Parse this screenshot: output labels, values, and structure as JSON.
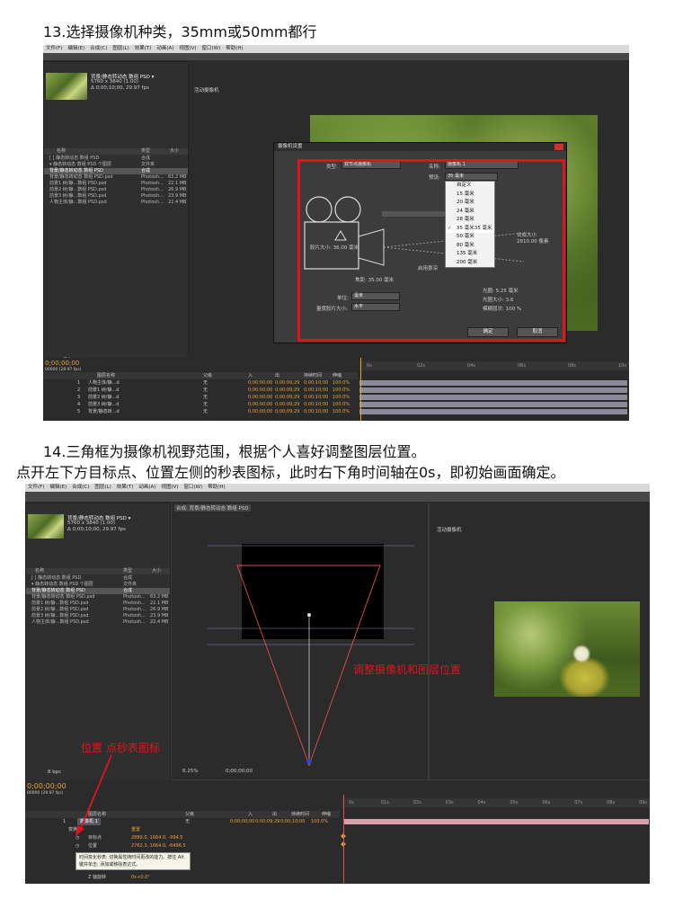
{
  "step13": {
    "heading": "13.选择摄像机种类，35mm或50mm都行"
  },
  "step14": {
    "heading_line1": "14.三角框为摄像机视野范围，根据个人喜好调整图层位置。",
    "heading_line2": "点开左下方目标点、位置左侧的秒表图标，此时右下角时间轴在0s，即初始画面确定。"
  },
  "menu": [
    "文件(F)",
    "编辑(E)",
    "合成(C)",
    "图层(L)",
    "效果(T)",
    "动画(A)",
    "视图(V)",
    "窗口(W)",
    "帮助(H)"
  ],
  "project": {
    "comp_title": "背景/静态转动态 数组 PSD ▾",
    "comp_info": "5760 x 3840 (1.00)",
    "comp_duration": "Δ 0;00;10;00, 29.97 fps",
    "col_name": "名称",
    "col_type": "类型",
    "col_size": "大小",
    "items": [
      {
        "name": "[ ] 静态转动态 数组 PSD",
        "type": "合成",
        "size": ""
      },
      {
        "name": "▾ 静态转动态 数组 PSD 个图层",
        "type": "文件夹",
        "size": ""
      },
      {
        "name": "背景/静态转动态 数组 PSD",
        "type": "合成",
        "size": ""
      },
      {
        "name": "背景/静态转动态 数组 PSD.psd",
        "type": "Photosh...",
        "size": "63.2 MB"
      },
      {
        "name": "前景1 树/静...数组 PSD.psd",
        "type": "Photosh...",
        "size": "22.1 MB"
      },
      {
        "name": "前景2 树/静...数组 PSD.psd",
        "type": "Photosh...",
        "size": "26.9 MB"
      },
      {
        "name": "前景3 树/静...数组 PSD.psd",
        "type": "Photosh...",
        "size": "23.9 MB"
      },
      {
        "name": "人物主体/静...数组 PSD.psd",
        "type": "Photosh...",
        "size": "22.4 MB"
      }
    ],
    "bpc": "8 bpc"
  },
  "viewer": {
    "label": "活动摄像机",
    "zoom": "6.25%",
    "timecode": "0;00;00;00",
    "tab_comp": "合成: 背景/静态转动态 数组 PSD"
  },
  "camera_dialog": {
    "title": "摄像机设置",
    "type_label": "类型:",
    "type_value": "双节点摄像机",
    "name_label": "名称:",
    "name_value": "摄像机 1",
    "preset_label": "预设:",
    "preset_value": "35 毫米",
    "film_size": "胶片大小: 36.00 毫米",
    "focal": "焦距: 35.00 毫米",
    "comp_size": "合成大小",
    "comp_size_val": "2810.00 像素",
    "units_label": "单位:",
    "units_value": "毫米",
    "measure_label": "量度胶片大小:",
    "measure_value": "水平",
    "enable_dof": "启用景深",
    "aperture": "光圈: 5.25 毫米",
    "fstop": "光圈大小: 3.6",
    "blur": "模糊层次: 100 %",
    "ok": "确定",
    "cancel": "取消",
    "presets": [
      "自定义",
      "15 毫米",
      "20 毫米",
      "24 毫米",
      "28 毫米",
      "35 毫米",
      "50 毫米",
      "80 毫米",
      "135 毫米",
      "200 毫米"
    ],
    "selected_preset_index": 5
  },
  "timeline": {
    "timecode": "0;00;00;00",
    "frame_info": "00000 (29.97 fps)",
    "col_layer": "图层名称",
    "col_parent": "父级",
    "col_in": "入",
    "col_out": "出",
    "col_duration": "持续时间",
    "col_stretch": "伸缩",
    "layers13": [
      {
        "num": "1",
        "name": "人物主体/静...d",
        "parent": "无",
        "in": "0;00;00;00",
        "out": "0;00;09;29",
        "dur": "0;00;10;00",
        "stretch": "100.0%"
      },
      {
        "num": "2",
        "name": "前景1 树/静...d",
        "parent": "无",
        "in": "0;00;00;00",
        "out": "0;00;09;29",
        "dur": "0;00;10;00",
        "stretch": "100.0%"
      },
      {
        "num": "3",
        "name": "前景2 树/静...d",
        "parent": "无",
        "in": "0;00;00;00",
        "out": "0;00;09;29",
        "dur": "0;00;10;00",
        "stretch": "100.0%"
      },
      {
        "num": "4",
        "name": "前景3 树/静...d",
        "parent": "无",
        "in": "0;00;00;00",
        "out": "0;00;09;29",
        "dur": "0;00;10;00",
        "stretch": "100.0%"
      },
      {
        "num": "5",
        "name": "背景/静态转...d",
        "parent": "无",
        "in": "0;00;00;00",
        "out": "0;00;09;29",
        "dur": "0;00;10;00",
        "stretch": "100.0%"
      }
    ],
    "ticks": [
      "0s",
      "02s",
      "04s",
      "06s",
      "08s",
      "10s"
    ],
    "ticks14": [
      "0s",
      "01s",
      "02s",
      "03s",
      "04s",
      "05s",
      "06s",
      "07s",
      "08s",
      "09s"
    ],
    "camera_layer": {
      "num": "1",
      "name": "摄像机 1",
      "parent": "无",
      "in": "0;00;00;00",
      "out": "0;00;09;29",
      "dur": "0;00;10;00",
      "stretch": "100.0%"
    },
    "transform": "变换",
    "reset": "重置",
    "target_label": "目标点",
    "target_value": "2880.0, 1664.0, -994.5",
    "position_label": "位置",
    "position_value": "2762.3, 1664.0, -6496.5",
    "tooltip": "时间变化秒表: 切换属性随时间更改的能力。按住 Alt 键并单击: 添加或移除表达式。",
    "z_label": "Z 轴旋转",
    "z_value": "0x+0.0°"
  },
  "annotations": {
    "adjust": "调整摄像机和图层位置",
    "position": "位置 点秒表图标"
  }
}
